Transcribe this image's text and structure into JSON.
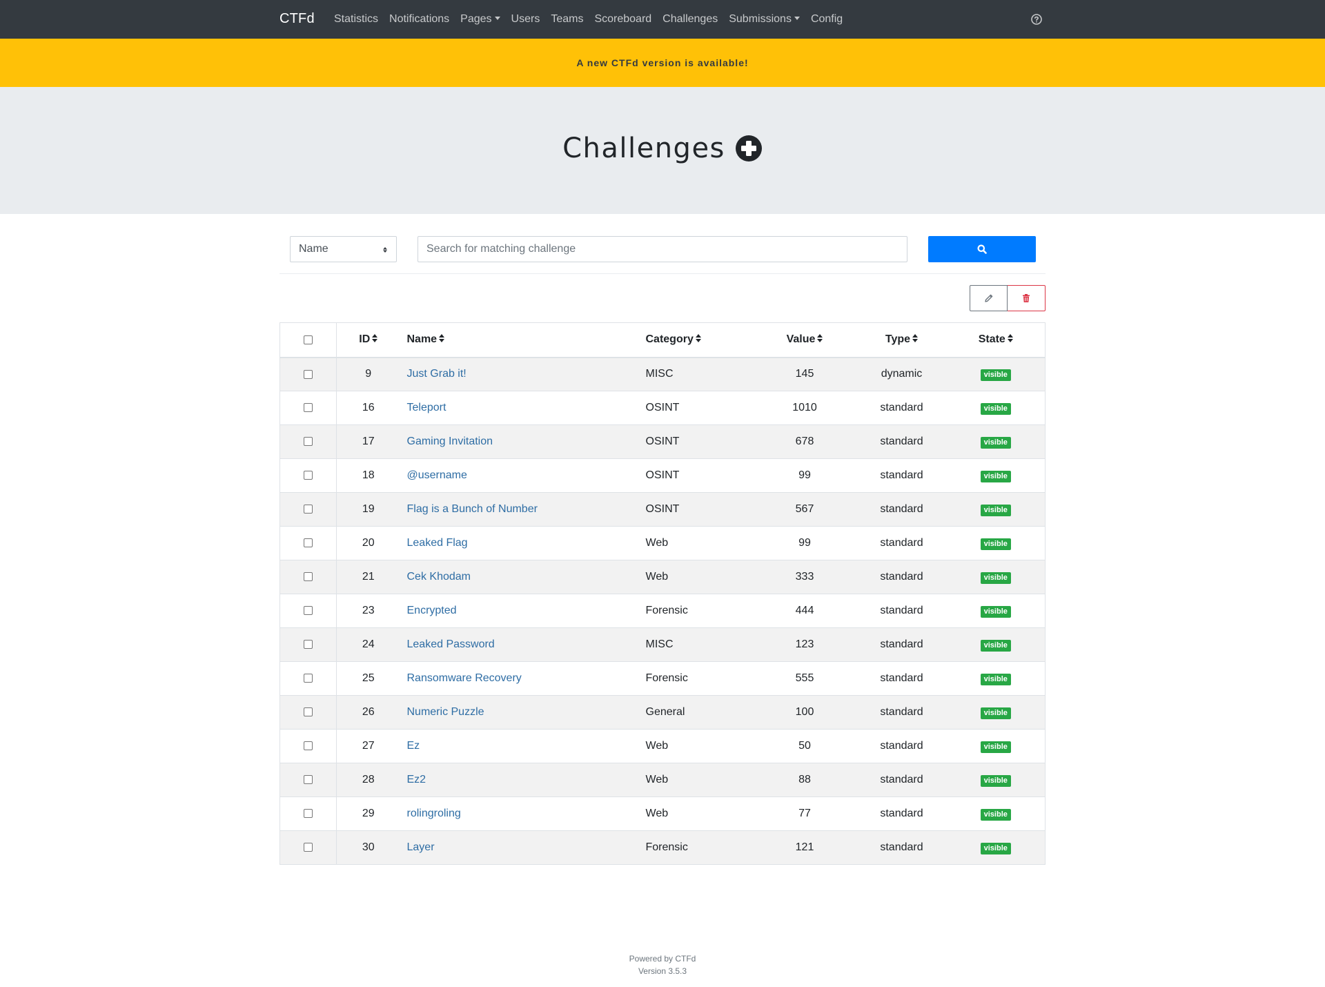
{
  "navbar": {
    "brand": "CTFd",
    "items": [
      {
        "label": "Statistics",
        "dropdown": false
      },
      {
        "label": "Notifications",
        "dropdown": false
      },
      {
        "label": "Pages",
        "dropdown": true
      },
      {
        "label": "Users",
        "dropdown": false
      },
      {
        "label": "Teams",
        "dropdown": false
      },
      {
        "label": "Scoreboard",
        "dropdown": false
      },
      {
        "label": "Challenges",
        "dropdown": false
      },
      {
        "label": "Submissions",
        "dropdown": true
      },
      {
        "label": "Config",
        "dropdown": false
      }
    ],
    "help_icon": "question-circle-icon"
  },
  "alert": {
    "text": "A new CTFd version is available!",
    "color": "#ffc107"
  },
  "page": {
    "title": "Challenges",
    "add_icon": "plus-circle-icon"
  },
  "search": {
    "field_selected": "Name",
    "placeholder": "Search for matching challenge",
    "button_icon": "search-icon",
    "button_color": "#007bff"
  },
  "bulk_actions": {
    "edit_icon": "pencil-icon",
    "delete_icon": "trash-icon"
  },
  "table": {
    "columns": [
      "ID",
      "Name",
      "Category",
      "Value",
      "Type",
      "State"
    ],
    "rows": [
      {
        "id": "9",
        "name": "Just Grab it!",
        "category": "MISC",
        "value": "145",
        "type": "dynamic",
        "state": "visible"
      },
      {
        "id": "16",
        "name": "Teleport",
        "category": "OSINT",
        "value": "1010",
        "type": "standard",
        "state": "visible"
      },
      {
        "id": "17",
        "name": "Gaming Invitation",
        "category": "OSINT",
        "value": "678",
        "type": "standard",
        "state": "visible"
      },
      {
        "id": "18",
        "name": "@username",
        "category": "OSINT",
        "value": "99",
        "type": "standard",
        "state": "visible"
      },
      {
        "id": "19",
        "name": "Flag is a Bunch of Number",
        "category": "OSINT",
        "value": "567",
        "type": "standard",
        "state": "visible"
      },
      {
        "id": "20",
        "name": "Leaked Flag",
        "category": "Web",
        "value": "99",
        "type": "standard",
        "state": "visible"
      },
      {
        "id": "21",
        "name": "Cek Khodam",
        "category": "Web",
        "value": "333",
        "type": "standard",
        "state": "visible"
      },
      {
        "id": "23",
        "name": "Encrypted",
        "category": "Forensic",
        "value": "444",
        "type": "standard",
        "state": "visible"
      },
      {
        "id": "24",
        "name": "Leaked Password",
        "category": "MISC",
        "value": "123",
        "type": "standard",
        "state": "visible"
      },
      {
        "id": "25",
        "name": "Ransomware Recovery",
        "category": "Forensic",
        "value": "555",
        "type": "standard",
        "state": "visible"
      },
      {
        "id": "26",
        "name": "Numeric Puzzle",
        "category": "General",
        "value": "100",
        "type": "standard",
        "state": "visible"
      },
      {
        "id": "27",
        "name": "Ez",
        "category": "Web",
        "value": "50",
        "type": "standard",
        "state": "visible"
      },
      {
        "id": "28",
        "name": "Ez2",
        "category": "Web",
        "value": "88",
        "type": "standard",
        "state": "visible"
      },
      {
        "id": "29",
        "name": "rolingroling",
        "category": "Web",
        "value": "77",
        "type": "standard",
        "state": "visible"
      },
      {
        "id": "30",
        "name": "Layer",
        "category": "Forensic",
        "value": "121",
        "type": "standard",
        "state": "visible"
      }
    ],
    "state_badge_color": "#28a745",
    "link_color": "#2e6da4"
  },
  "footer": {
    "line1": "Powered by CTFd",
    "line2": "Version 3.5.3"
  }
}
